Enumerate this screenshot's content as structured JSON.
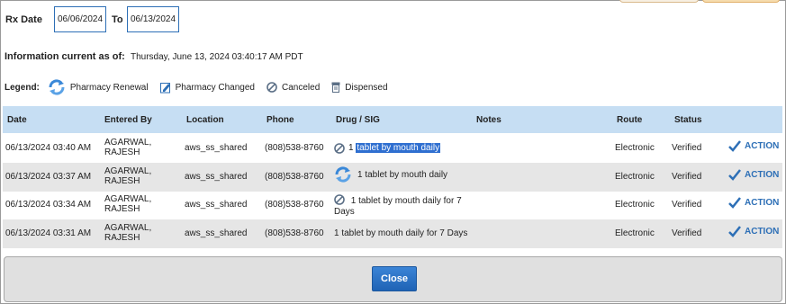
{
  "filters": {
    "rx_date_label": "Rx Date",
    "from_date": "06/06/2024",
    "to_label": "To",
    "to_date": "06/13/2024"
  },
  "info": {
    "label": "Information current as of:",
    "value": "Thursday, June 13, 2024 03:40:17 AM PDT"
  },
  "legend": {
    "title": "Legend:",
    "items": [
      {
        "icon": "renewal-icon",
        "label": "Pharmacy Renewal"
      },
      {
        "icon": "edit-icon",
        "label": "Pharmacy Changed"
      },
      {
        "icon": "canceled-icon",
        "label": "Canceled"
      },
      {
        "icon": "dispensed-icon",
        "label": "Dispensed"
      }
    ]
  },
  "table": {
    "columns": [
      "Date",
      "Entered By",
      "Location",
      "Phone",
      "Drug / SIG",
      "Notes",
      "Route",
      "Status"
    ],
    "rows": [
      {
        "date": "06/13/2024 03:40 AM",
        "entered_1": "AGARWAL,",
        "entered_2": "RAJESH",
        "location": "aws_ss_shared",
        "phone": "(808)538-8760",
        "drug_icon": "canceled-icon",
        "drug_prefix": "1",
        "drug_hl": "tablet by mouth daily",
        "drug_line2": "",
        "route": "Electronic",
        "status": "Verified",
        "action": "ACTION"
      },
      {
        "date": "06/13/2024 03:37 AM",
        "entered_1": "AGARWAL,",
        "entered_2": "RAJESH",
        "location": "aws_ss_shared",
        "phone": "(808)538-8760",
        "drug_icon": "renewal-icon",
        "drug_prefix": "1 tablet by mouth daily",
        "drug_hl": "",
        "drug_line2": "",
        "route": "Electronic",
        "status": "Verified",
        "action": "ACTION"
      },
      {
        "date": "06/13/2024 03:34 AM",
        "entered_1": "AGARWAL,",
        "entered_2": "RAJESH",
        "location": "aws_ss_shared",
        "phone": "(808)538-8760",
        "drug_icon": "canceled-icon",
        "drug_prefix": "1 tablet by mouth daily for 7",
        "drug_hl": "",
        "drug_line2": "Days",
        "route": "Electronic",
        "status": "Verified",
        "action": "ACTION"
      },
      {
        "date": "06/13/2024 03:31 AM",
        "entered_1": "AGARWAL,",
        "entered_2": "RAJESH",
        "location": "aws_ss_shared",
        "phone": "(808)538-8760",
        "drug_icon": "",
        "drug_prefix": "1 tablet by mouth daily for 7 Days",
        "drug_hl": "",
        "drug_line2": "",
        "route": "Electronic",
        "status": "Verified",
        "action": "ACTION"
      }
    ]
  },
  "footer": {
    "close_label": "Close"
  },
  "colors": {
    "header_bg": "#c6def3",
    "accent": "#2d6fb6",
    "highlight": "#2f6fd0"
  }
}
